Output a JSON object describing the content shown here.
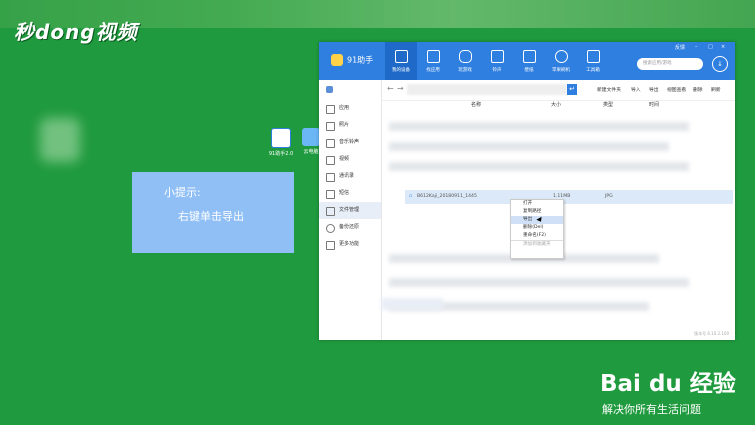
{
  "brand": {
    "video_logo": "秒dong视频"
  },
  "tip": {
    "title": "小提示:",
    "body": "右键单击导出"
  },
  "desktop": {
    "icons": [
      "91助手2.0",
      "云电脑"
    ]
  },
  "app": {
    "name": "91助手",
    "nav": [
      "我的设备",
      "找应用",
      "玩游戏",
      "铃声",
      "壁纸",
      "苹果刷机",
      "工具箱"
    ],
    "window_controls": [
      "反馈",
      "–",
      "□",
      "×"
    ],
    "search_placeholder": "搜索应用/游戏",
    "sidebar": [
      "应用",
      "照片",
      "音乐铃声",
      "视频",
      "通讯录",
      "短信",
      "文件管理",
      "备份还原",
      "更多功能"
    ],
    "toolbar": {
      "new_folder": "新建文件夹",
      "import": "导入",
      "export": "导出",
      "view": "视图查看",
      "delete": "删除",
      "refresh": "刷新"
    },
    "columns": {
      "name": "名称",
      "size": "大小",
      "type": "类型",
      "time": "时间"
    },
    "selected_file": {
      "name": "B612Kaji_20180911_1445",
      "size": "1.11MB",
      "type": "JPG"
    },
    "context_menu": [
      "打开",
      "复制路径",
      "导出",
      "删除(Del)",
      "重命名(F2)",
      "添加到收藏夹"
    ],
    "version": "版本号 6.10.2.100"
  },
  "watermark": {
    "brand": "Bai du 经验",
    "slogan": "解决你所有生活问题"
  }
}
